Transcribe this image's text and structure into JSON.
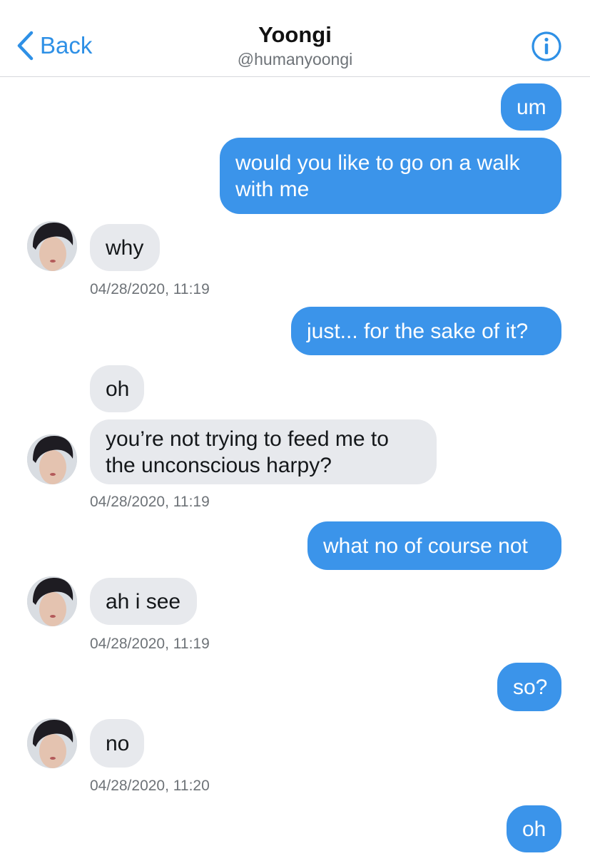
{
  "header": {
    "back_label": "Back",
    "title": "Yoongi",
    "handle": "@humanyoongi"
  },
  "messages": [
    {
      "dir": "out",
      "text": "um"
    },
    {
      "dir": "out",
      "text": "would you like to go on a walk with me"
    },
    {
      "dir": "in",
      "text": "why"
    },
    {
      "dir": "stamp",
      "text": "04/28/2020, 11:19"
    },
    {
      "dir": "out",
      "text": "just... for the sake of it?"
    },
    {
      "dir": "in",
      "text": "oh"
    },
    {
      "dir": "in",
      "text": "you’re not trying to feed me to the unconscious harpy?"
    },
    {
      "dir": "stamp",
      "text": "04/28/2020, 11:19"
    },
    {
      "dir": "out",
      "text": "what no of course not"
    },
    {
      "dir": "in",
      "text": "ah i see"
    },
    {
      "dir": "stamp",
      "text": "04/28/2020, 11:19"
    },
    {
      "dir": "out",
      "text": "so?"
    },
    {
      "dir": "in",
      "text": "no"
    },
    {
      "dir": "stamp",
      "text": "04/28/2020, 11:20"
    },
    {
      "dir": "out",
      "text": "oh"
    }
  ],
  "colors": {
    "accent": "#2e90e6",
    "outgoing_bubble": "#3b94ea",
    "incoming_bubble": "#e7e9ed"
  },
  "icons": {
    "back": "chevron-left-icon",
    "info": "info-circle-icon"
  }
}
